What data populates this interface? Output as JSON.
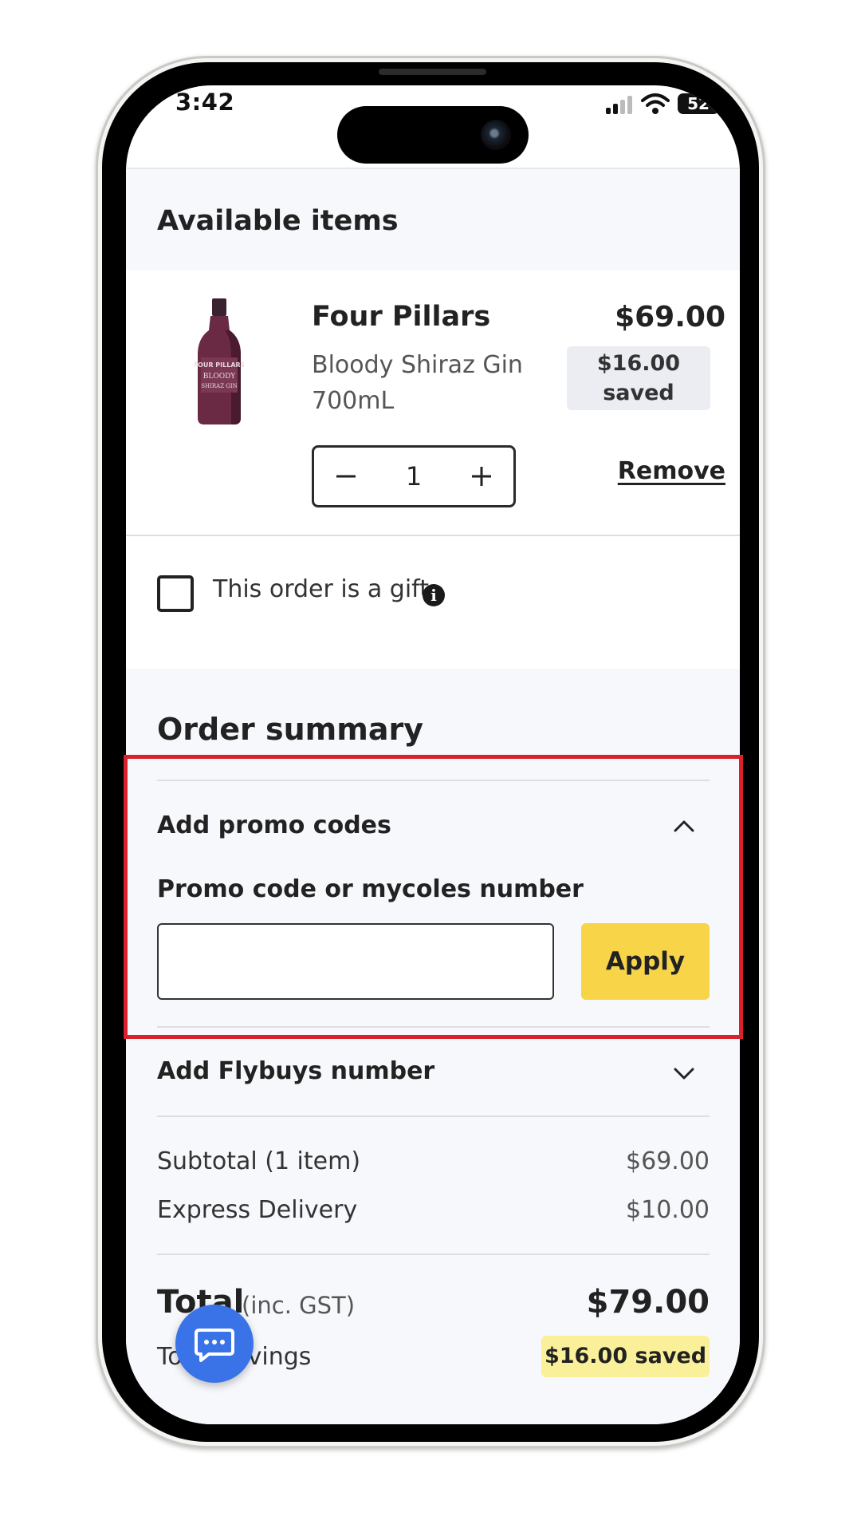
{
  "status_bar": {
    "time": "3:42",
    "battery": "52",
    "signal_icon": "signal-icon",
    "wifi_icon": "wifi-icon"
  },
  "available_items": {
    "heading": "Available items",
    "product": {
      "brand": "Four Pillars",
      "name_line1": "Bloody Shiraz Gin",
      "name_line2": "700mL",
      "price": "$69.00",
      "saved_amount": "$16.00",
      "saved_label": "saved",
      "quantity": "1",
      "remove_label": "Remove",
      "image_icon": "gin-bottle-image"
    }
  },
  "gift": {
    "label": "This order is a gift",
    "checked": false,
    "info_icon": "info-icon"
  },
  "order_summary": {
    "heading": "Order summary",
    "promo": {
      "title": "Add promo codes",
      "expanded": true,
      "field_label": "Promo code or mycoles number",
      "input_value": "",
      "apply_label": "Apply"
    },
    "flybuys": {
      "title": "Add Flybuys number",
      "expanded": false
    },
    "subtotal_label": "Subtotal (1 item)",
    "subtotal_value": "$69.00",
    "delivery_label": "Express Delivery",
    "delivery_value": "$10.00",
    "total_label": "Total",
    "total_note": "(inc. GST)",
    "total_value": "$79.00",
    "savings_label": "Total savings",
    "savings_value": "$16.00 saved"
  },
  "colors": {
    "apply_button": "#f7d448",
    "savings_badge": "#fbf09a",
    "highlight_border": "#d9212c",
    "chat_button": "#3a73e8"
  },
  "chat": {
    "icon": "chat-icon"
  }
}
